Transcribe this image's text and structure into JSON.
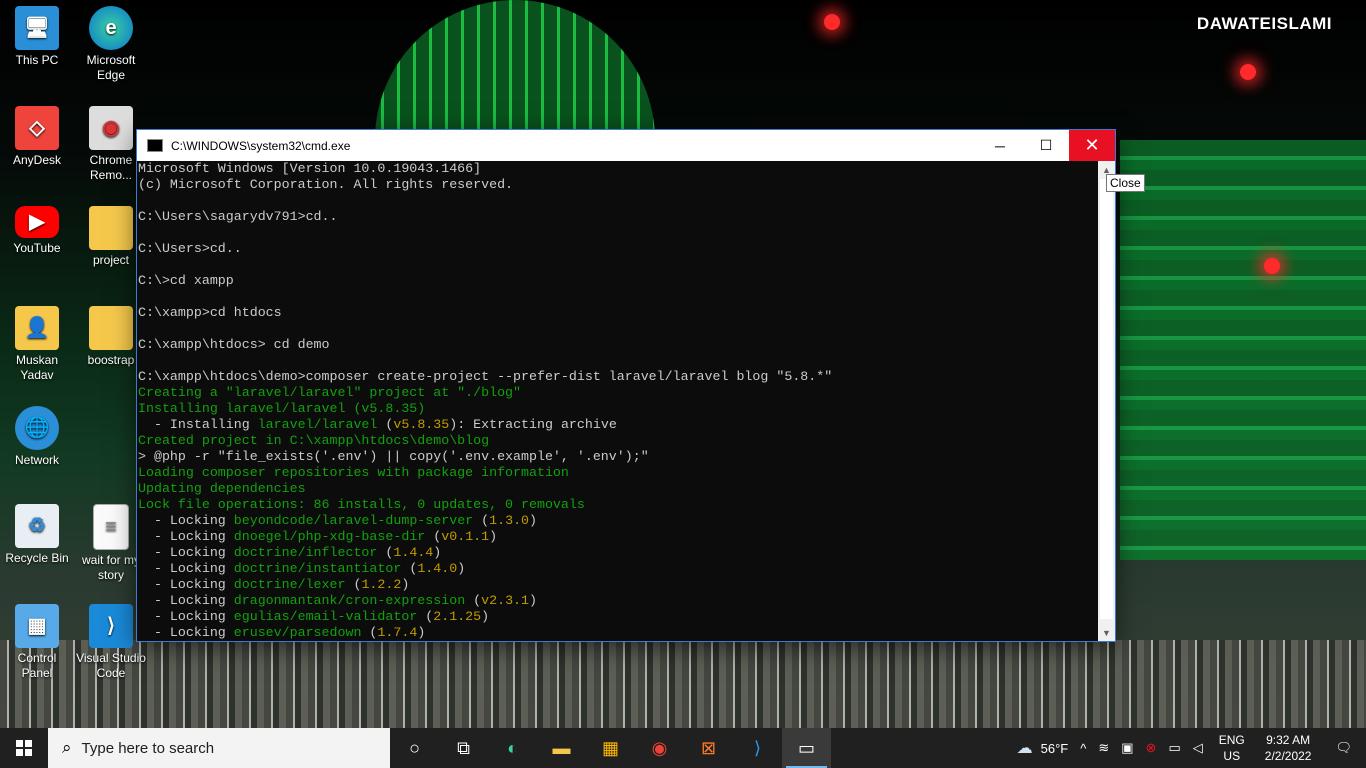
{
  "wallpaper": {
    "brand": "DAWATEISLAMI"
  },
  "desktop_icons": [
    {
      "label": "This PC",
      "icon": "computer-icon"
    },
    {
      "label": "Microsoft Edge",
      "icon": "edge-icon"
    },
    {
      "label": "AnyDesk",
      "icon": "anydesk-icon"
    },
    {
      "label": "Chrome Remo...",
      "icon": "chrome-remote-icon"
    },
    {
      "label": "YouTube",
      "icon": "youtube-icon"
    },
    {
      "label": "project",
      "icon": "folder-icon"
    },
    {
      "label": "Muskan Yadav",
      "icon": "user-folder-icon"
    },
    {
      "label": "boostrap",
      "icon": "folder-icon"
    },
    {
      "label": "Network",
      "icon": "network-icon"
    },
    {
      "label": "Recycle Bin",
      "icon": "recycle-bin-icon"
    },
    {
      "label": "wait for my story",
      "icon": "text-file-icon"
    },
    {
      "label": "Control Panel",
      "icon": "control-panel-icon"
    },
    {
      "label": "Visual Studio Code",
      "icon": "vscode-icon"
    }
  ],
  "window": {
    "title": "C:\\WINDOWS\\system32\\cmd.exe",
    "tooltip": "Close",
    "lines": [
      [
        {
          "t": "Microsoft Windows [Version 10.0.19043.1466]",
          "c": ""
        }
      ],
      [
        {
          "t": "(c) Microsoft Corporation. All rights reserved.",
          "c": ""
        }
      ],
      [
        {
          "t": "",
          "c": ""
        }
      ],
      [
        {
          "t": "C:\\Users\\sagarydv791>cd..",
          "c": ""
        }
      ],
      [
        {
          "t": "",
          "c": ""
        }
      ],
      [
        {
          "t": "C:\\Users>cd..",
          "c": ""
        }
      ],
      [
        {
          "t": "",
          "c": ""
        }
      ],
      [
        {
          "t": "C:\\>cd xampp",
          "c": ""
        }
      ],
      [
        {
          "t": "",
          "c": ""
        }
      ],
      [
        {
          "t": "C:\\xampp>cd htdocs",
          "c": ""
        }
      ],
      [
        {
          "t": "",
          "c": ""
        }
      ],
      [
        {
          "t": "C:\\xampp\\htdocs> cd demo",
          "c": ""
        }
      ],
      [
        {
          "t": "",
          "c": ""
        }
      ],
      [
        {
          "t": "C:\\xampp\\htdocs\\demo>composer create-project --prefer-dist laravel/laravel blog \"5.8.*\"",
          "c": ""
        }
      ],
      [
        {
          "t": "Creating a \"laravel/laravel\" project at \"./blog\"",
          "c": "g"
        }
      ],
      [
        {
          "t": "Installing laravel/laravel (v5.8.35)",
          "c": "g"
        }
      ],
      [
        {
          "t": "  - Installing ",
          "c": ""
        },
        {
          "t": "laravel/laravel",
          "c": "g"
        },
        {
          "t": " (",
          "c": ""
        },
        {
          "t": "v5.8.35",
          "c": "y"
        },
        {
          "t": "): Extracting archive",
          "c": ""
        }
      ],
      [
        {
          "t": "Created project in C:\\xampp\\htdocs\\demo\\blog",
          "c": "g"
        }
      ],
      [
        {
          "t": "> @php -r \"file_exists('.env') || copy('.env.example', '.env');\"",
          "c": ""
        }
      ],
      [
        {
          "t": "Loading composer repositories with package information",
          "c": "g"
        }
      ],
      [
        {
          "t": "Updating dependencies",
          "c": "g"
        }
      ],
      [
        {
          "t": "Lock file operations: 86 installs, 0 updates, 0 removals",
          "c": "g"
        }
      ],
      [
        {
          "t": "  - Locking ",
          "c": ""
        },
        {
          "t": "beyondcode/laravel-dump-server",
          "c": "g"
        },
        {
          "t": " (",
          "c": ""
        },
        {
          "t": "1.3.0",
          "c": "y"
        },
        {
          "t": ")",
          "c": ""
        }
      ],
      [
        {
          "t": "  - Locking ",
          "c": ""
        },
        {
          "t": "dnoegel/php-xdg-base-dir",
          "c": "g"
        },
        {
          "t": " (",
          "c": ""
        },
        {
          "t": "v0.1.1",
          "c": "y"
        },
        {
          "t": ")",
          "c": ""
        }
      ],
      [
        {
          "t": "  - Locking ",
          "c": ""
        },
        {
          "t": "doctrine/inflector",
          "c": "g"
        },
        {
          "t": " (",
          "c": ""
        },
        {
          "t": "1.4.4",
          "c": "y"
        },
        {
          "t": ")",
          "c": ""
        }
      ],
      [
        {
          "t": "  - Locking ",
          "c": ""
        },
        {
          "t": "doctrine/instantiator",
          "c": "g"
        },
        {
          "t": " (",
          "c": ""
        },
        {
          "t": "1.4.0",
          "c": "y"
        },
        {
          "t": ")",
          "c": ""
        }
      ],
      [
        {
          "t": "  - Locking ",
          "c": ""
        },
        {
          "t": "doctrine/lexer",
          "c": "g"
        },
        {
          "t": " (",
          "c": ""
        },
        {
          "t": "1.2.2",
          "c": "y"
        },
        {
          "t": ")",
          "c": ""
        }
      ],
      [
        {
          "t": "  - Locking ",
          "c": ""
        },
        {
          "t": "dragonmantank/cron-expression",
          "c": "g"
        },
        {
          "t": " (",
          "c": ""
        },
        {
          "t": "v2.3.1",
          "c": "y"
        },
        {
          "t": ")",
          "c": ""
        }
      ],
      [
        {
          "t": "  - Locking ",
          "c": ""
        },
        {
          "t": "egulias/email-validator",
          "c": "g"
        },
        {
          "t": " (",
          "c": ""
        },
        {
          "t": "2.1.25",
          "c": "y"
        },
        {
          "t": ")",
          "c": ""
        }
      ],
      [
        {
          "t": "  - Locking ",
          "c": ""
        },
        {
          "t": "erusev/parsedown",
          "c": "g"
        },
        {
          "t": " (",
          "c": ""
        },
        {
          "t": "1.7.4",
          "c": "y"
        },
        {
          "t": ")",
          "c": ""
        }
      ]
    ]
  },
  "taskbar": {
    "search_placeholder": "Type here to search",
    "weather": "56°F",
    "lang_top": "ENG",
    "lang_bottom": "US",
    "time": "9:32 AM",
    "date": "2/2/2022"
  }
}
